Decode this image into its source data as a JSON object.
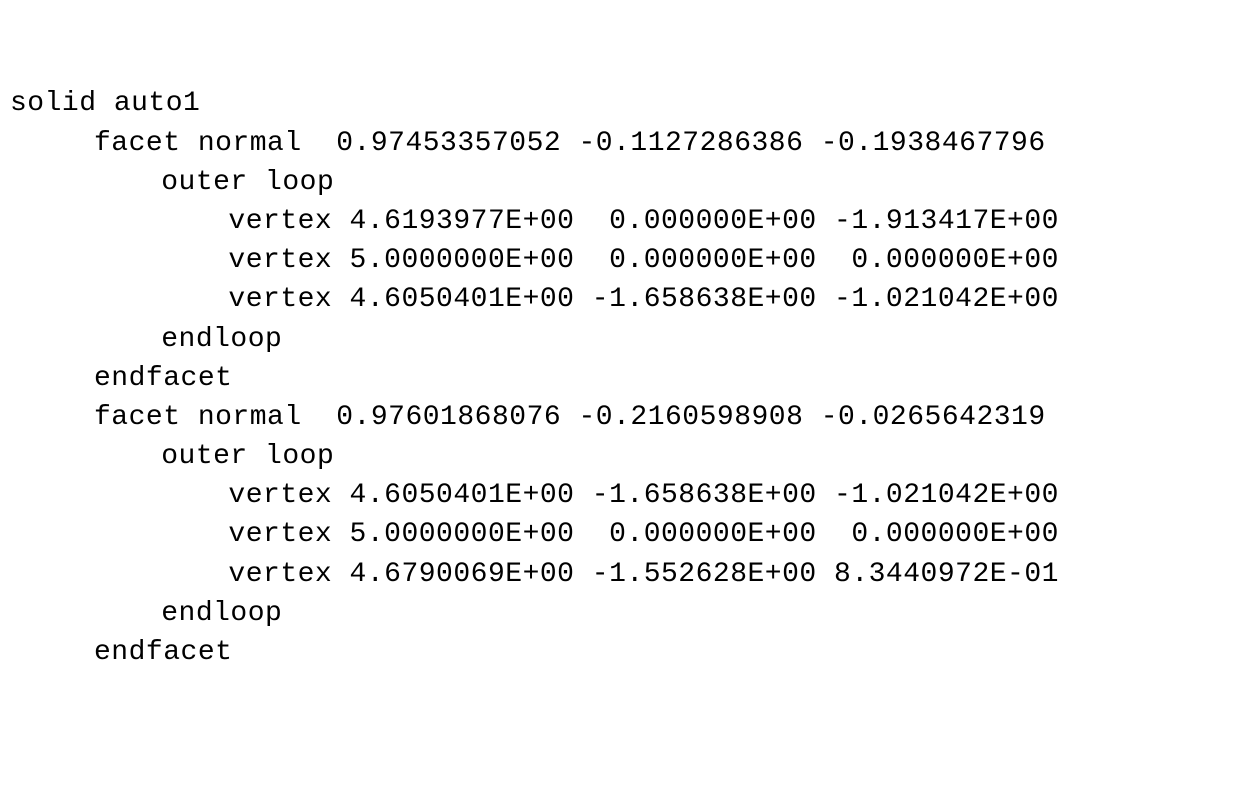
{
  "stl": {
    "header": "solid auto1",
    "facets": [
      {
        "normal_line": "facet normal  0.97453357052 -0.1127286386 -0.1938467796",
        "outer_loop": "outer loop",
        "vertices": [
          "vertex 4.6193977E+00  0.000000E+00 -1.913417E+00",
          "vertex 5.0000000E+00  0.000000E+00  0.000000E+00",
          "vertex 4.6050401E+00 -1.658638E+00 -1.021042E+00"
        ],
        "endloop": "endloop",
        "endfacet": "endfacet"
      },
      {
        "normal_line": "facet normal  0.97601868076 -0.2160598908 -0.0265642319",
        "outer_loop": "outer loop",
        "vertices": [
          "vertex 4.6050401E+00 -1.658638E+00 -1.021042E+00",
          "vertex 5.0000000E+00  0.000000E+00  0.000000E+00",
          "vertex 4.6790069E+00 -1.552628E+00 8.3440972E-01"
        ],
        "endloop": "endloop",
        "endfacet": "endfacet"
      }
    ]
  }
}
